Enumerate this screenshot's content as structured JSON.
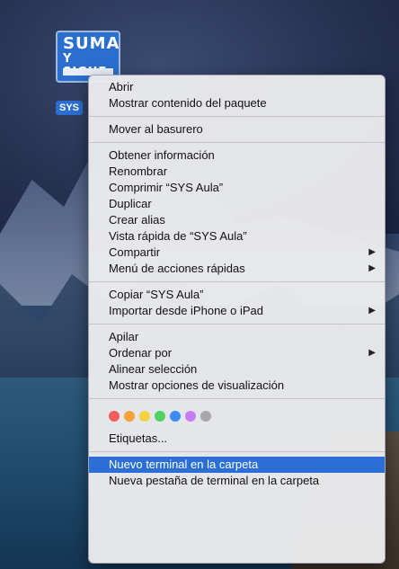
{
  "desktop_icon": {
    "logo_line1": "SUMA",
    "logo_line2": "Y SIGUE",
    "label": "SYS"
  },
  "menu": {
    "sections": [
      [
        "Abrir",
        "Mostrar contenido del paquete"
      ],
      [
        "Mover al basurero"
      ],
      [
        "Obtener información",
        "Renombrar",
        "Comprimir “SYS Aula”",
        "Duplicar",
        "Crear alias",
        "Vista rápida de “SYS Aula”",
        "Compartir",
        "Menú de acciones rápidas"
      ],
      [
        "Copiar “SYS Aula”",
        "Importar desde iPhone o iPad"
      ],
      [
        "Apilar",
        "Ordenar por",
        "Alinear selección",
        "Mostrar opciones de visualización"
      ]
    ],
    "tag_colors": [
      "#f25c5c",
      "#f5a23a",
      "#f5d340",
      "#4fd163",
      "#3b8cf5",
      "#c77df2",
      "#a7a7aa"
    ],
    "tags_label": "Etiquetas...",
    "bottom_items": [
      "Nuevo terminal en la carpeta",
      "Nueva pestaña de terminal en la carpeta"
    ],
    "submenu_arrow": "▶",
    "highlight_color": "#2b6fd6"
  }
}
